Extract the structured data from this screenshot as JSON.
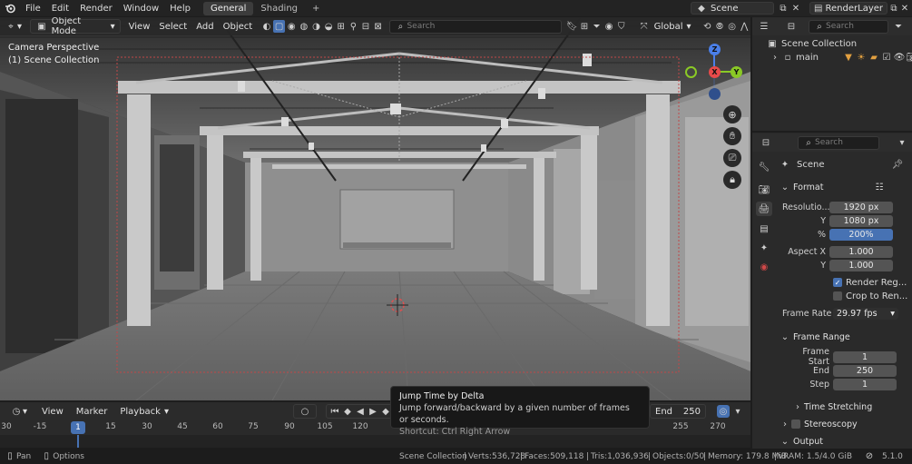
{
  "menu": {
    "items": [
      "File",
      "Edit",
      "Render",
      "Window",
      "Help"
    ],
    "workspaces": [
      "General",
      "Shading"
    ],
    "add_workspace": "+",
    "scene": "Scene",
    "view_layer": "RenderLayer"
  },
  "viewport": {
    "mode": "Object Mode",
    "menus": [
      "View",
      "Select",
      "Add",
      "Object"
    ],
    "search_placeholder": "Search",
    "orientation": "Global",
    "overlay_title": "Camera Perspective",
    "overlay_collection": "(1) Scene Collection",
    "gizmo": {
      "x": "X",
      "y": "Y",
      "z": "Z"
    }
  },
  "outliner": {
    "search_placeholder": "Search",
    "root": "Scene Collection",
    "child": "main"
  },
  "properties": {
    "search_placeholder": "Search",
    "context": "Scene",
    "format": {
      "title": "Format",
      "resolution_x_label": "Resolutio...",
      "resolution_x": "1920 px",
      "resolution_y_label": "Y",
      "resolution_y": "1080 px",
      "percent_label": "%",
      "percent": "200%",
      "aspect_x_label": "Aspect X",
      "aspect_x": "1.000",
      "aspect_y_label": "Y",
      "aspect_y": "1.000",
      "render_region": "Render Reg...",
      "crop_region": "Crop to Ren...",
      "frame_rate_label": "Frame Rate",
      "frame_rate": "29.97 fps"
    },
    "frame_range": {
      "title": "Frame Range",
      "start_label": "Frame Start",
      "start": "1",
      "end_label": "End",
      "end": "250",
      "step_label": "Step",
      "step": "1"
    },
    "time_stretching": "Time Stretching",
    "stereoscopy": "Stereoscopy",
    "output": "Output"
  },
  "timeline": {
    "menus": [
      "View",
      "Marker",
      "Playback"
    ],
    "end_label": "End",
    "end_value": "250",
    "current_frame": "1",
    "ticks": [
      "30",
      "-15",
      "1",
      "15",
      "30",
      "45",
      "60",
      "75",
      "90",
      "105",
      "120",
      "255",
      "270"
    ]
  },
  "tooltip": {
    "title": "Jump Time by Delta",
    "description": "Jump forward/backward by a given number of frames or seconds.",
    "shortcut": "Shortcut: Ctrl Right Arrow"
  },
  "status": {
    "pan": "Pan",
    "options": "Options",
    "collection": "Scene Collection",
    "verts": "Verts:536,728",
    "faces": "Faces:509,118",
    "tris": "Tris:1,036,936",
    "objects": "Objects:0/50",
    "memory": "Memory: 179.8 MiB",
    "vram": "VRAM: 1.5/4.0 GiB",
    "version": "5.1.0"
  },
  "colors": {
    "accent": "#4772b3",
    "x_axis": "#e84a4a",
    "y_axis": "#8ac926",
    "z_axis": "#4a7fe8"
  }
}
